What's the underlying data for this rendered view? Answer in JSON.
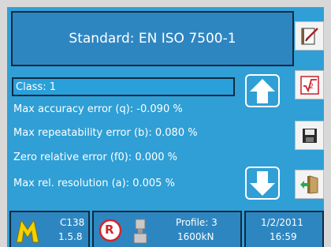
{
  "header": {
    "title": "Standard: EN ISO 7500-1"
  },
  "params": {
    "selected": "Class: 1",
    "rows": [
      "Max accuracy error (q): -0.090 %",
      "Max repeatability error (b): 0.080 %",
      "Zero relative error (f0): 0.000 %",
      "Max rel. resolution (a): 0.005 %"
    ]
  },
  "status": {
    "device_id": "C138",
    "version": "1.5.8",
    "reset_badge": "R",
    "profile": "Profile: 3",
    "capacity": "1600kN",
    "date": "1/2/2011",
    "time": "16:59"
  },
  "colors": {
    "background": "#2f9fd6",
    "panel": "#2e86c1",
    "border": "#15293f",
    "logo_yellow": "#f2d200",
    "badge_red": "#d2262a"
  },
  "icons": {
    "up": "up-arrow-icon",
    "down": "down-arrow-icon",
    "edit": "edit-document-icon",
    "formula": "square-root-icon",
    "save": "floppy-disk-icon",
    "exit": "exit-door-icon"
  }
}
